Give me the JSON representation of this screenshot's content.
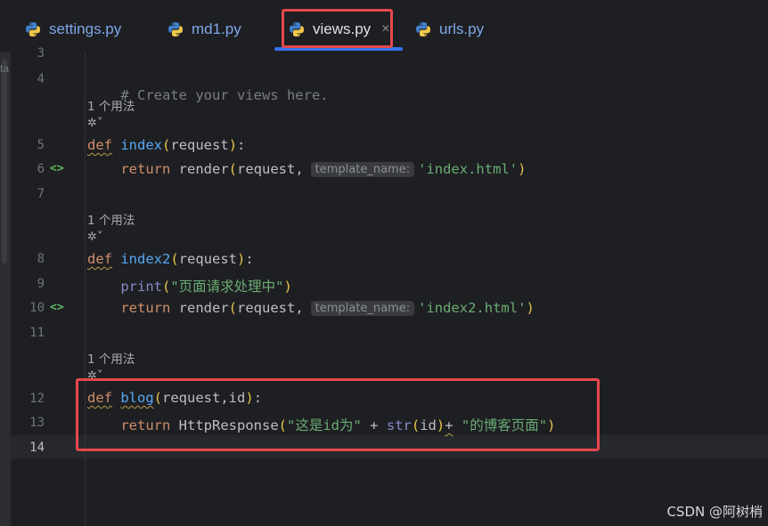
{
  "tabs": [
    {
      "label": "settings.py",
      "icon": "python-icon",
      "active": false
    },
    {
      "label": "md1.py",
      "icon": "python-icon",
      "active": false
    },
    {
      "label": "views.py",
      "icon": "python-icon",
      "active": true,
      "close": "×"
    },
    {
      "label": "urls.py",
      "icon": "python-icon",
      "active": false
    }
  ],
  "left_edge_text": "ta",
  "gutter": {
    "line_numbers": [
      "3",
      "4",
      "5",
      "6",
      "7",
      "8",
      "9",
      "10",
      "11",
      "12",
      "13",
      "14"
    ],
    "run_icon": "<>"
  },
  "usage_hint": "1 个用法",
  "code": {
    "comment": "# Create your views here.",
    "kw_def": "def",
    "kw_return": "return",
    "index_name": "index",
    "index2_name": "index2",
    "blog_name": "blog",
    "request_param": "request",
    "blog_params": "request,id",
    "render_call": "render",
    "request_arg": "request,",
    "inlay_hint": "template_name:",
    "index_html": "'index.html'",
    "index2_html": "'index2.html'",
    "print_call": "print",
    "print_str": "\"页面请求处理中\"",
    "http_response": "HttpResponse",
    "blog_str1": "\"这是id为\"",
    "plus": "+",
    "str_call": "str",
    "id_arg": "id",
    "blog_str2": "\"的博客页面\"",
    "colon": ":",
    "open_paren": "(",
    "close_paren": ")"
  },
  "watermark": "CSDN @阿树梢",
  "colors": {
    "background": "#1e1f22",
    "keyword": "#cf8e6d",
    "function": "#56a8f5",
    "string": "#6aab73",
    "accent": "#3574f0",
    "highlight_box": "#e5484d"
  }
}
